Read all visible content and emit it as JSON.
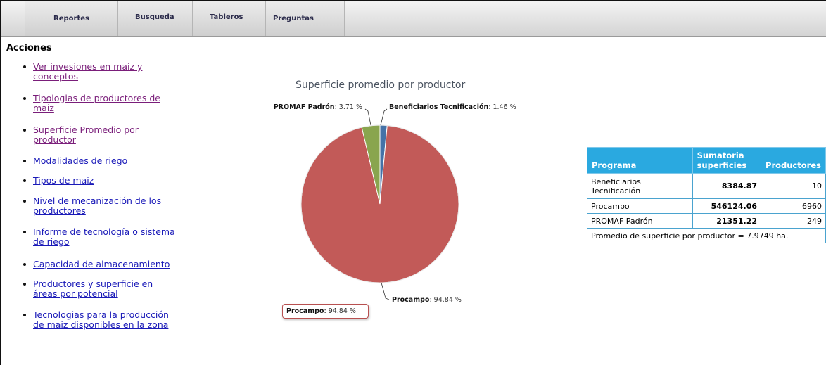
{
  "nav": {
    "items": [
      {
        "label": "Reportes"
      },
      {
        "label": "Busqueda"
      },
      {
        "label": "Tableros"
      },
      {
        "label": "Preguntas"
      }
    ]
  },
  "sidebar": {
    "heading": "Acciones",
    "items": [
      {
        "line1": "Ver invesiones en maiz y",
        "line2": "conceptos",
        "visited": true
      },
      {
        "line1": "Tipologias de productores de",
        "line2": "maiz",
        "visited": true
      },
      {
        "line1": "Superficie Promedio por",
        "line2": "productor",
        "visited": true
      },
      {
        "line1": "Modalidades de riego",
        "line2": "",
        "visited": false
      },
      {
        "line1": "Tipos de maiz",
        "line2": "",
        "visited": false
      },
      {
        "line1": "Nivel de mecanización de los",
        "line2": "productores",
        "visited": false
      },
      {
        "line1": "Informe de tecnología o sistema",
        "line2": "de riego",
        "visited": false
      },
      {
        "line1": "Capacidad de almacenamiento",
        "line2": "",
        "visited": false
      },
      {
        "line1": "Productores y superficie en",
        "line2": "áreas por potencial",
        "visited": false
      },
      {
        "line1": "Tecnologias para la producción",
        "line2": "de maiz disponibles en la zona",
        "visited": false
      }
    ]
  },
  "chart_data": {
    "type": "pie",
    "title": "Superficie promedio por productor",
    "slices": [
      {
        "name": "Beneficiarios Tecnificación",
        "value": 1.46,
        "label": "1.46 %",
        "color": "#4572a7"
      },
      {
        "name": "Procampo",
        "value": 94.84,
        "label": "94.84 %",
        "color": "#c25a58"
      },
      {
        "name": "PROMAF Padrón",
        "value": 3.71,
        "label": "3.71 %",
        "color": "#89a54e"
      }
    ],
    "tooltip": {
      "name": "Procampo",
      "label": "94.84 %"
    }
  },
  "table": {
    "headers": [
      "Programa",
      "Sumatoria superficies",
      "Productores"
    ],
    "rows": [
      {
        "programa": "Beneficiarios Tecnificación",
        "superficie": "8384.87",
        "productores": "10"
      },
      {
        "programa": "Procampo",
        "superficie": "546124.06",
        "productores": "6960"
      },
      {
        "programa": "PROMAF Padrón",
        "superficie": "21351.22",
        "productores": "249"
      }
    ],
    "footer": "Promedio de superficie por productor = 7.9749 ha."
  },
  "colors": {
    "header_blue": "#2aa9e0",
    "visited_link": "#7a1e7a",
    "link": "#1a1ab8"
  }
}
